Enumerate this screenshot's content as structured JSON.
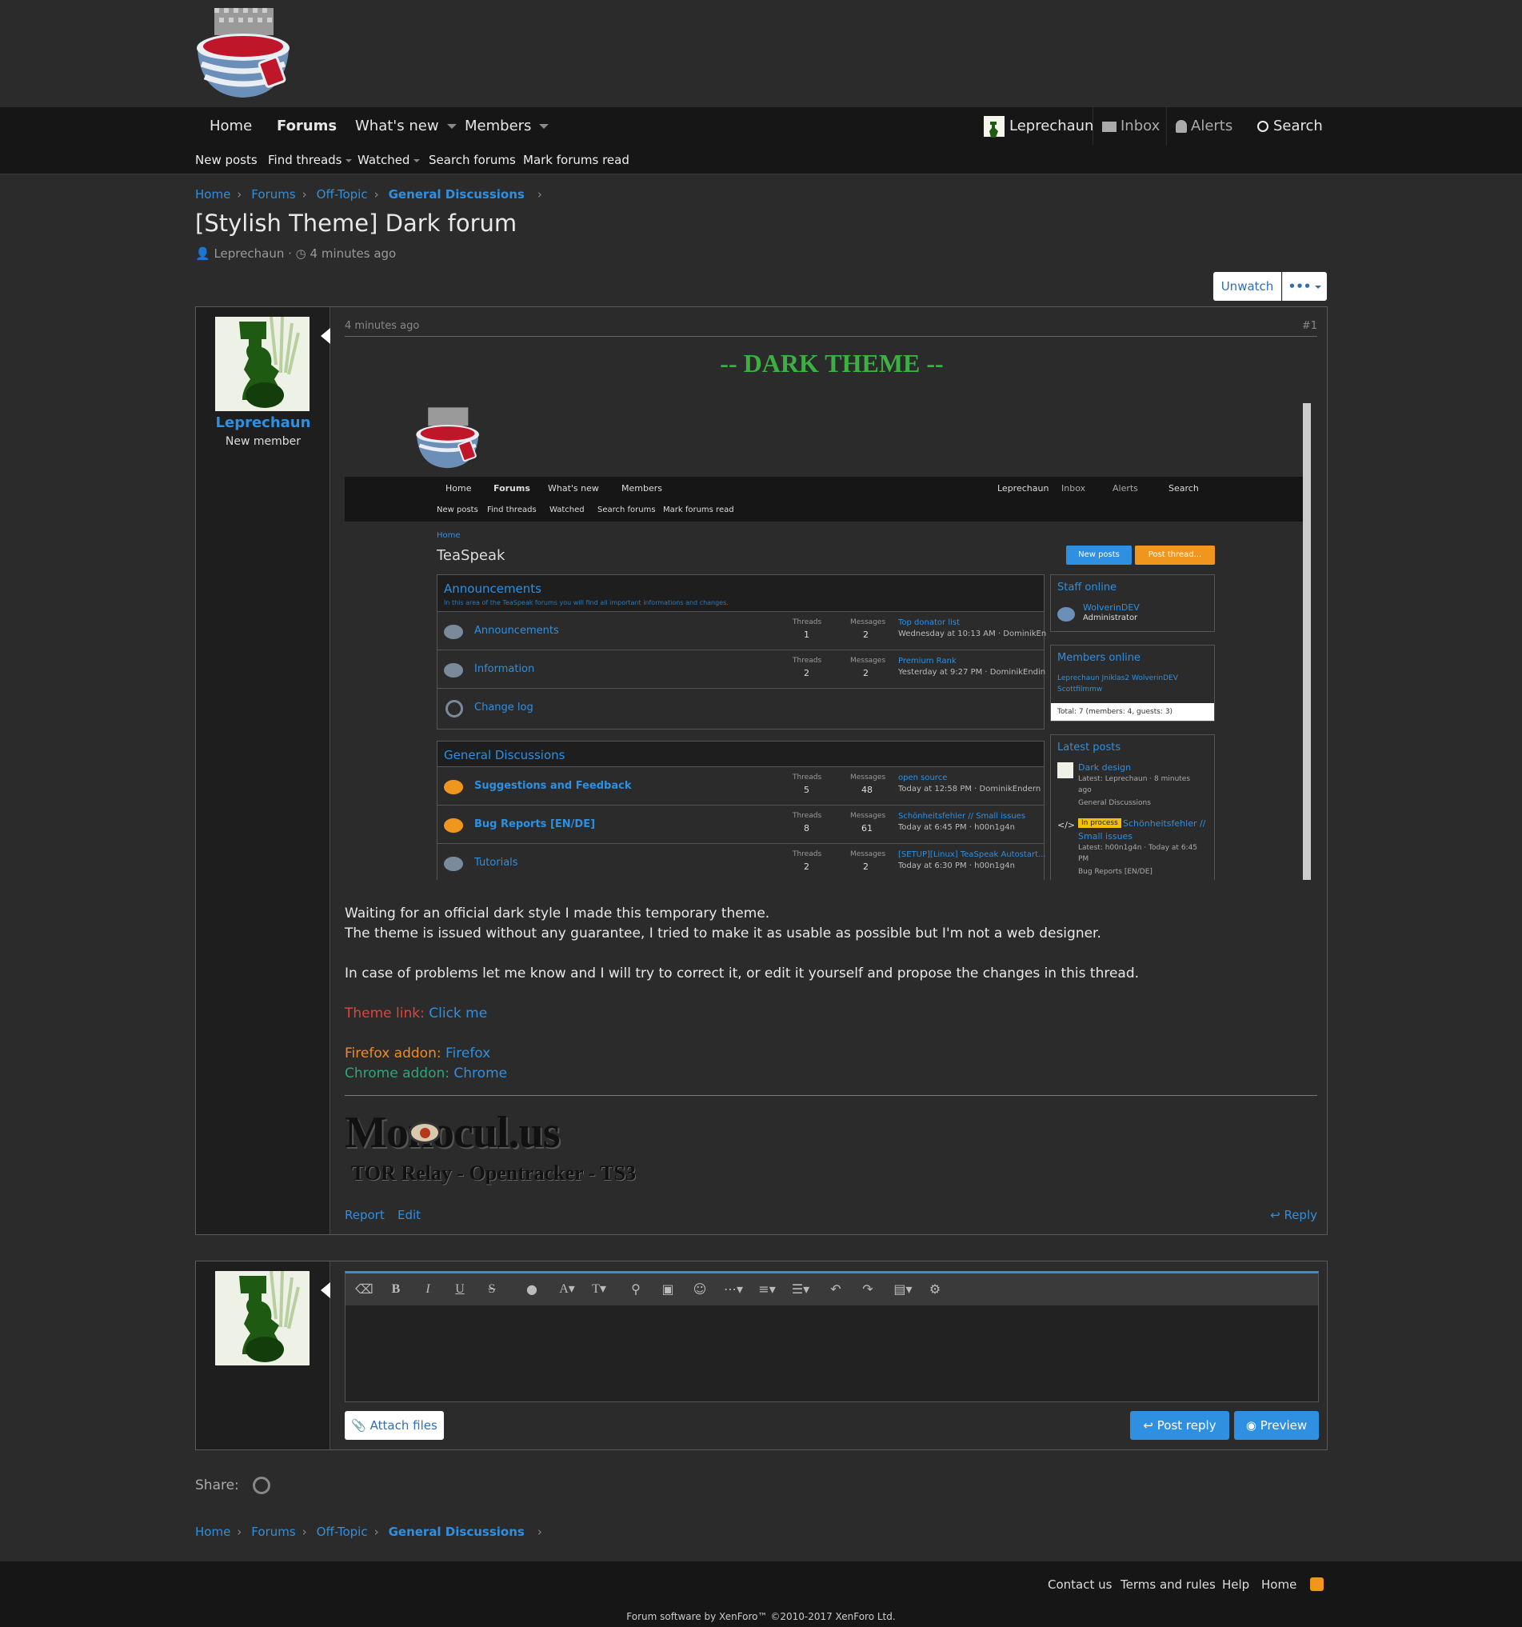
{
  "header": {
    "logo_name": "teaspeak-logo"
  },
  "nav": {
    "items": [
      {
        "label": "Home"
      },
      {
        "label": "Forums"
      },
      {
        "label": "What's new"
      },
      {
        "label": "Members"
      }
    ],
    "user": "Leprechaun",
    "inbox": "Inbox",
    "alerts": "Alerts",
    "search": "Search"
  },
  "subnav": {
    "items": [
      {
        "label": "New posts"
      },
      {
        "label": "Find threads"
      },
      {
        "label": "Watched"
      },
      {
        "label": "Search forums"
      },
      {
        "label": "Mark forums read"
      }
    ]
  },
  "breadcrumb": [
    "Home",
    "Forums",
    "Off-Topic",
    "General Discussions"
  ],
  "thread": {
    "title": "[Stylish Theme] Dark forum",
    "author": "Leprechaun",
    "time": "4 minutes ago",
    "unwatch": "Unwatch",
    "more": "•••"
  },
  "post": {
    "username": "Leprechaun",
    "role": "New member",
    "time": "4 minutes ago",
    "number": "#1",
    "heading": "-- DARK THEME --",
    "para1a": "Waiting for an official dark style I made this temporary theme.",
    "para1b": "The theme is issued without any guarantee, I tried to make it as usable as possible but I'm not a web designer.",
    "para2": "In case of problems let me know and I will try to correct it, or edit it yourself and propose the changes in this thread.",
    "theme_label": "Theme link:",
    "theme_link": "Click me",
    "firefox_label": "Firefox addon:",
    "firefox_link": "Firefox",
    "chrome_label": "Chrome addon:",
    "chrome_link": "Chrome",
    "sig_title": "Monocul.us",
    "sig_sub": "TOR Relay - Opentracker - TS3",
    "report": "Report",
    "edit": "Edit",
    "reply": "Reply",
    "colors": {
      "heading": "#3cb043",
      "theme": "#e0443a",
      "firefox": "#f08a24",
      "chrome": "#2aa876",
      "link": "#2f8fe0"
    }
  },
  "screenshot": {
    "nav": [
      "Home",
      "Forums",
      "What's new",
      "Members"
    ],
    "user": "Leprechaun",
    "inbox": "Inbox",
    "alerts": "Alerts",
    "search": "Search",
    "subnav": [
      "New posts",
      "Find threads",
      "Watched",
      "Search forums",
      "Mark forums read"
    ],
    "crumb": "Home",
    "title": "TeaSpeak",
    "new_posts": "New posts",
    "post_thread": "Post thread...",
    "cat1": {
      "title": "Announcements",
      "desc": "In this area of the TeaSpeak forums you will find all important informations and changes.",
      "rows": [
        {
          "name": "Announcements",
          "threads": "1",
          "messages": "2",
          "last": "Top donator list",
          "meta": "Wednesday at 10:13 AM · DominikEn"
        },
        {
          "name": "Information",
          "threads": "2",
          "messages": "2",
          "last": "Premium Rank",
          "meta": "Yesterday at 9:27 PM · DominikEndin"
        },
        {
          "name": "Change log",
          "threads": "",
          "messages": "",
          "last": "",
          "meta": ""
        }
      ]
    },
    "cat2": {
      "title": "General Discussions",
      "rows": [
        {
          "name": "Suggestions and Feedback",
          "threads": "5",
          "messages": "48",
          "last": "open source",
          "meta": "Today at 12:58 PM · DominikEndern"
        },
        {
          "name": "Bug Reports [EN/DE]",
          "threads": "8",
          "messages": "61",
          "last": "Schönheitsfehler // Small issues",
          "meta": "Today at 6:45 PM · h00n1g4n"
        },
        {
          "name": "Tutorials",
          "threads": "2",
          "messages": "2",
          "last": "[SETUP][Linux] TeaSpeak Autostart...",
          "meta": "Today at 6:30 PM · h00n1g4n"
        }
      ]
    },
    "threads_label": "Threads",
    "messages_label": "Messages",
    "staff": {
      "title": "Staff online",
      "name": "WolverinDEV",
      "role": "Administrator"
    },
    "members": {
      "title": "Members online",
      "names": "Leprechaun  Jniklas2  WolverinDEV",
      "names2": "Scottfilmmw",
      "total": "Total: 7 (members: 4, guests: 3)"
    },
    "latest": {
      "title": "Latest posts",
      "p1": "Dark design",
      "p1meta": "Latest: Leprechaun · 8 minutes",
      "p1meta2": "ago",
      "p1forum": "General Discussions",
      "badge": "In process",
      "p2": "Schönheitsfehler //",
      "p2b": "Small issues",
      "p2meta": "Latest: h00n1g4n · Today at 6:45",
      "p2meta2": "PM",
      "p2forum": "Bug Reports [EN/DE]"
    }
  },
  "editor": {
    "attach": "Attach files",
    "post_reply": "Post reply",
    "preview": "Preview"
  },
  "share": {
    "label": "Share:"
  },
  "footer": {
    "links": [
      "Contact us",
      "Terms and rules",
      "Help",
      "Home"
    ],
    "copyright": "Forum software by XenForo™ ©2010-2017 XenForo Ltd."
  }
}
